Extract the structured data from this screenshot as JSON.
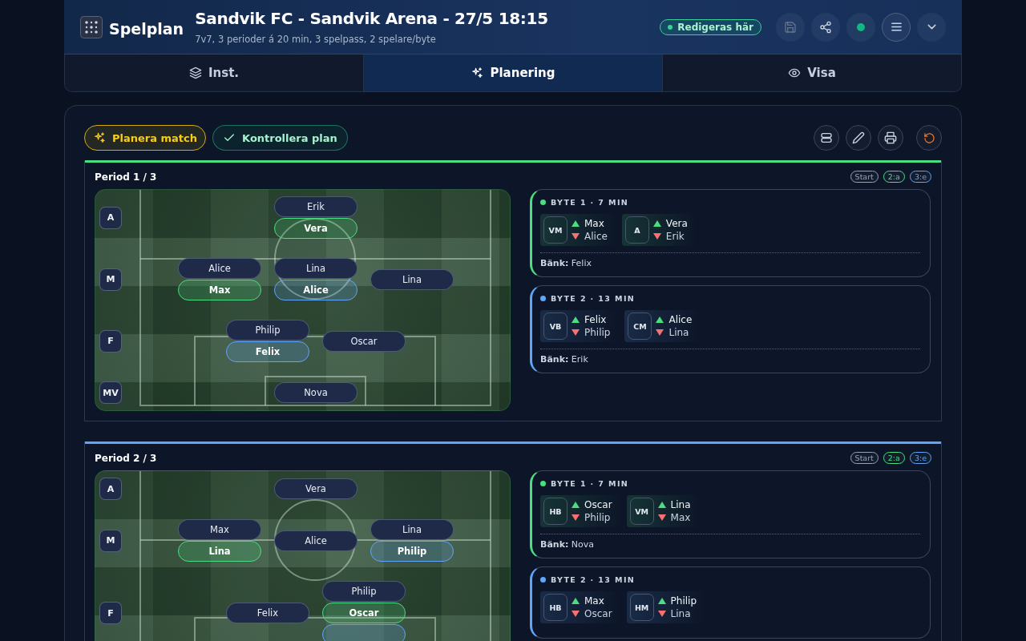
{
  "header": {
    "app_name": "Spelplan",
    "title": "Sandvik FC - Sandvik Arena - 27/5 18:15",
    "subtitle": "7v7, 3 perioder á 20 min, 3 spelpass, 2 spelare/byte",
    "status_badge": "Redigeras här",
    "save_disabled": true,
    "online": true
  },
  "tabs": [
    {
      "label": "Inst.",
      "kind": "settings",
      "selected": false
    },
    {
      "label": "Planering",
      "kind": "planning",
      "selected": true
    },
    {
      "label": "Visa",
      "kind": "view",
      "selected": false
    }
  ],
  "toolbar": {
    "buttons": [
      {
        "label": "Planera match",
        "kind": "plan"
      },
      {
        "label": "Kontrollera plan",
        "kind": "check"
      }
    ]
  },
  "periods": [
    {
      "title": "Period 1 / 3",
      "color": "#4ade80",
      "stages": [
        {
          "label": "Start",
          "color": "#94a3b8"
        },
        {
          "label": "2:a",
          "color": "#4ade80"
        },
        {
          "label": "3:e",
          "color": "#60a5fa"
        }
      ],
      "lines": [
        {
          "label": "A",
          "slots": [
            {
              "players": [
                {
                  "name": "Erik"
                },
                {
                  "name": "Vera",
                  "color": "#4ade80"
                }
              ]
            }
          ]
        },
        {
          "label": "M",
          "slots": [
            {
              "players": [
                {
                  "name": "Alice"
                },
                {
                  "name": "Max",
                  "color": "#4ade80"
                }
              ]
            },
            {
              "players": [
                {
                  "name": "Lina"
                },
                {
                  "name": "Alice",
                  "color": "#60a5fa"
                }
              ]
            },
            {
              "players": [
                {
                  "name": "Lina"
                }
              ]
            }
          ]
        },
        {
          "label": "F",
          "slots": [
            {
              "players": [
                {
                  "name": "Philip"
                },
                {
                  "name": "Felix",
                  "color": "#60a5fa"
                }
              ]
            },
            {
              "players": [
                {
                  "name": "Oscar"
                }
              ]
            }
          ]
        },
        {
          "label": "MV",
          "slots": [
            {
              "players": [
                {
                  "name": "Nova"
                }
              ]
            }
          ]
        }
      ],
      "subs": [
        {
          "heading": "BYTE 1 · 7 MIN",
          "color": "#4ade80",
          "swaps": [
            {
              "position": "VM",
              "in": "Max",
              "out": "Alice"
            },
            {
              "position": "A",
              "in": "Vera",
              "out": "Erik"
            }
          ],
          "bench": "**Bänk:** Felix"
        },
        {
          "heading": "BYTE 2 · 13 MIN",
          "color": "#60a5fa",
          "swaps": [
            {
              "position": "VB",
              "in": "Felix",
              "out": "Philip"
            },
            {
              "position": "CM",
              "in": "Alice",
              "out": "Lina"
            }
          ],
          "bench": "**Bänk:** Erik"
        }
      ]
    },
    {
      "title": "Period 2 / 3",
      "color": "#60a5fa",
      "stages": [
        {
          "label": "Start",
          "color": "#94a3b8"
        },
        {
          "label": "2:a",
          "color": "#4ade80"
        },
        {
          "label": "3:e",
          "color": "#60a5fa"
        }
      ],
      "lines": [
        {
          "label": "A",
          "slots": [
            {
              "players": [
                {
                  "name": "Vera"
                }
              ]
            }
          ]
        },
        {
          "label": "M",
          "slots": [
            {
              "players": [
                {
                  "name": "Max"
                },
                {
                  "name": "Lina",
                  "color": "#4ade80"
                }
              ]
            },
            {
              "players": [
                {
                  "name": "Alice"
                }
              ]
            },
            {
              "players": [
                {
                  "name": "Lina"
                },
                {
                  "name": "Philip",
                  "color": "#60a5fa"
                }
              ]
            }
          ]
        },
        {
          "label": "F",
          "slots": [
            {
              "players": [
                {
                  "name": "Felix"
                }
              ]
            },
            {
              "players": [
                {
                  "name": "Philip"
                },
                {
                  "name": "Oscar",
                  "color": "#4ade80"
                },
                {
                  "color": "#60a5fa"
                }
              ]
            }
          ]
        }
      ],
      "subs": [
        {
          "heading": "BYTE 1 · 7 MIN",
          "color": "#4ade80",
          "swaps": [
            {
              "position": "HB",
              "in": "Oscar",
              "out": "Philip"
            },
            {
              "position": "VM",
              "in": "Lina",
              "out": "Max"
            }
          ],
          "bench": "**Bänk:** Nova"
        },
        {
          "heading": "BYTE 2 · 13 MIN",
          "color": "#60a5fa",
          "swaps": [
            {
              "position": "HB",
              "in": "Max",
              "out": "Oscar"
            },
            {
              "position": "HM",
              "in": "Philip",
              "out": "Lina"
            }
          ]
        }
      ]
    }
  ]
}
